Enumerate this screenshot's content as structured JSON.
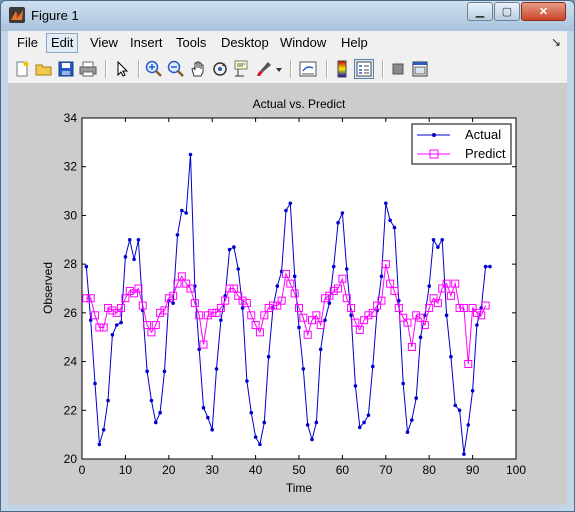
{
  "window": {
    "title": "Figure 1"
  },
  "menu": {
    "items": [
      "File",
      "Edit",
      "View",
      "Insert",
      "Tools",
      "Desktop",
      "Window",
      "Help"
    ],
    "active_index": 1
  },
  "toolbar": {
    "icons": [
      "new-figure-icon",
      "open-file-icon",
      "save-icon",
      "print-icon",
      "pointer-icon",
      "zoom-in-icon",
      "zoom-out-icon",
      "pan-hand-icon",
      "rotate-3d-icon",
      "data-cursor-icon",
      "brush-icon",
      "brush-dropdown-icon",
      "link-plot-icon",
      "colorbar-icon",
      "legend-icon",
      "hide-plot-tools-icon",
      "show-plot-tools-icon"
    ]
  },
  "chart_data": {
    "type": "line",
    "title": "Actual vs. Predict",
    "xlabel": "Time",
    "ylabel": "Observed",
    "xlim": [
      0,
      100
    ],
    "ylim": [
      20,
      34
    ],
    "xticks": [
      0,
      10,
      20,
      30,
      40,
      50,
      60,
      70,
      80,
      90,
      100
    ],
    "yticks": [
      20,
      22,
      24,
      26,
      28,
      30,
      32,
      34
    ],
    "legend_position": "top-right",
    "grid": false,
    "series": [
      {
        "name": "Actual",
        "color": "#0000cc",
        "marker": "dot",
        "x": [
          1,
          2,
          3,
          4,
          5,
          6,
          7,
          8,
          9,
          10,
          11,
          12,
          13,
          14,
          15,
          16,
          17,
          18,
          19,
          20,
          21,
          22,
          23,
          24,
          25,
          26,
          27,
          28,
          29,
          30,
          31,
          32,
          33,
          34,
          35,
          36,
          37,
          38,
          39,
          40,
          41,
          42,
          43,
          44,
          45,
          46,
          47,
          48,
          49,
          50,
          51,
          52,
          53,
          54,
          55,
          56,
          57,
          58,
          59,
          60,
          61,
          62,
          63,
          64,
          65,
          66,
          67,
          68,
          69,
          70,
          71,
          72,
          73,
          74,
          75,
          76,
          77,
          78,
          79,
          80,
          81,
          82,
          83,
          84,
          85,
          86,
          87,
          88,
          89,
          90,
          91,
          92,
          93,
          94
        ],
        "values": [
          27.9,
          25.7,
          23.1,
          20.6,
          21.2,
          22.4,
          25.1,
          25.5,
          25.6,
          28.3,
          29.0,
          28.2,
          29.0,
          26.1,
          23.6,
          22.4,
          21.5,
          21.9,
          23.6,
          26.5,
          26.4,
          29.2,
          30.2,
          30.1,
          32.5,
          27.1,
          24.5,
          22.1,
          21.7,
          21.2,
          23.7,
          25.7,
          26.7,
          28.6,
          28.7,
          27.8,
          26.2,
          23.2,
          21.9,
          20.9,
          20.6,
          21.5,
          24.2,
          26.2,
          27.1,
          27.7,
          30.2,
          30.5,
          27.5,
          25.4,
          23.7,
          21.4,
          20.8,
          21.5,
          24.5,
          25.7,
          26.4,
          27.9,
          29.7,
          30.1,
          27.8,
          25.9,
          23.0,
          21.3,
          21.5,
          21.8,
          23.8,
          26.1,
          27.5,
          30.5,
          29.8,
          29.5,
          26.5,
          23.1,
          21.1,
          21.6,
          22.5,
          25.0,
          25.9,
          27.1,
          29.0,
          28.7,
          29.0,
          25.9,
          24.2,
          22.2,
          22.0,
          20.2,
          21.4,
          22.8,
          25.5,
          26.2,
          27.9,
          27.9
        ]
      },
      {
        "name": "Predict",
        "color": "#ff00ff",
        "marker": "square",
        "x": [
          1,
          2,
          3,
          4,
          5,
          6,
          7,
          8,
          9,
          10,
          11,
          12,
          13,
          14,
          15,
          16,
          17,
          18,
          19,
          20,
          21,
          22,
          23,
          24,
          25,
          26,
          27,
          28,
          29,
          30,
          31,
          32,
          33,
          34,
          35,
          36,
          37,
          38,
          39,
          40,
          41,
          42,
          43,
          44,
          45,
          46,
          47,
          48,
          49,
          50,
          51,
          52,
          53,
          54,
          55,
          56,
          57,
          58,
          59,
          60,
          61,
          62,
          63,
          64,
          65,
          66,
          67,
          68,
          69,
          70,
          71,
          72,
          73,
          74,
          75,
          76,
          77,
          78,
          79,
          80,
          81,
          82,
          83,
          84,
          85,
          86,
          87,
          88,
          89,
          90,
          91,
          92,
          93
        ],
        "values": [
          26.6,
          26.6,
          25.9,
          25.4,
          25.4,
          26.2,
          26.1,
          26.0,
          26.2,
          26.6,
          26.9,
          26.8,
          27.0,
          26.3,
          25.5,
          25.2,
          25.5,
          26.0,
          26.1,
          26.6,
          26.7,
          27.2,
          27.5,
          27.2,
          27.0,
          26.4,
          25.9,
          24.7,
          25.9,
          26.0,
          26.0,
          26.2,
          26.5,
          27.0,
          27.0,
          26.7,
          26.5,
          26.4,
          25.9,
          25.5,
          25.2,
          25.9,
          26.2,
          26.3,
          26.3,
          26.5,
          27.6,
          27.2,
          26.8,
          26.2,
          25.8,
          25.1,
          25.7,
          25.9,
          25.5,
          26.6,
          26.7,
          26.9,
          27.0,
          27.4,
          26.6,
          26.2,
          25.6,
          25.3,
          25.7,
          25.9,
          26.0,
          26.3,
          26.5,
          28.0,
          27.2,
          26.9,
          26.2,
          25.8,
          25.6,
          24.6,
          25.9,
          25.8,
          25.5,
          26.2,
          26.6,
          26.4,
          27.0,
          27.2,
          26.7,
          27.2,
          26.2,
          26.2,
          23.9,
          26.2,
          26.0,
          25.9,
          26.3
        ]
      }
    ]
  }
}
